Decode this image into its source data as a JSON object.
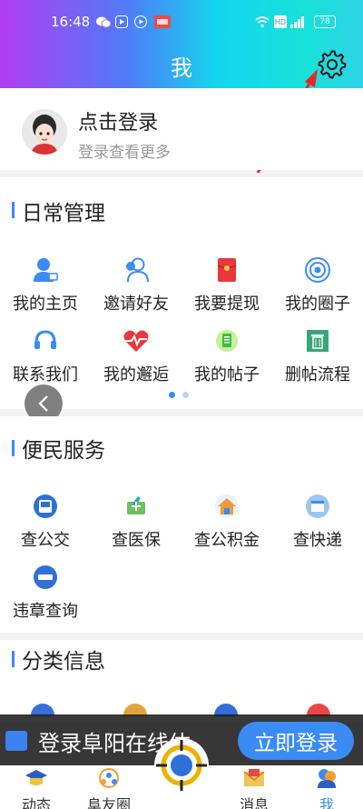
{
  "status": {
    "time": "16:48",
    "battery": "78",
    "hd": "HD"
  },
  "header": {
    "title": "我"
  },
  "profile": {
    "title": "点击登录",
    "subtitle": "登录查看更多"
  },
  "daily": {
    "heading": "日常管理",
    "items": [
      {
        "label": "我的主页",
        "icon": "user-home-icon"
      },
      {
        "label": "邀请好友",
        "icon": "invite-friends-icon"
      },
      {
        "label": "我要提现",
        "icon": "red-envelope-icon"
      },
      {
        "label": "我的圈子",
        "icon": "circle-target-icon"
      },
      {
        "label": "联系我们",
        "icon": "headset-icon"
      },
      {
        "label": "我的邂逅",
        "icon": "heartbeat-icon"
      },
      {
        "label": "我的帖子",
        "icon": "post-icon"
      },
      {
        "label": "删帖流程",
        "icon": "trash-icon"
      }
    ]
  },
  "service": {
    "heading": "便民服务",
    "items": [
      {
        "label": "查公交",
        "icon": "bus-icon"
      },
      {
        "label": "查医保",
        "icon": "medical-insurance-icon"
      },
      {
        "label": "查公积金",
        "icon": "housing-fund-icon"
      },
      {
        "label": "查快递",
        "icon": "express-icon"
      },
      {
        "label": "违章查询",
        "icon": "violation-icon"
      }
    ]
  },
  "category": {
    "heading": "分类信息"
  },
  "banner": {
    "text": "登录阜阳在线体",
    "button": "立即登录"
  },
  "nav": {
    "items": [
      {
        "label": "动态",
        "icon": "graduation-cap-icon"
      },
      {
        "label": "阜友圈",
        "icon": "friends-circle-icon"
      },
      {
        "label": "",
        "icon": "target-center-icon"
      },
      {
        "label": "消息",
        "icon": "mail-icon"
      },
      {
        "label": "我",
        "icon": "profile-icon"
      }
    ]
  },
  "colors": {
    "accent": "#3b8cf5",
    "header_start": "#b23cf2",
    "header_end": "#2fd2e6"
  }
}
